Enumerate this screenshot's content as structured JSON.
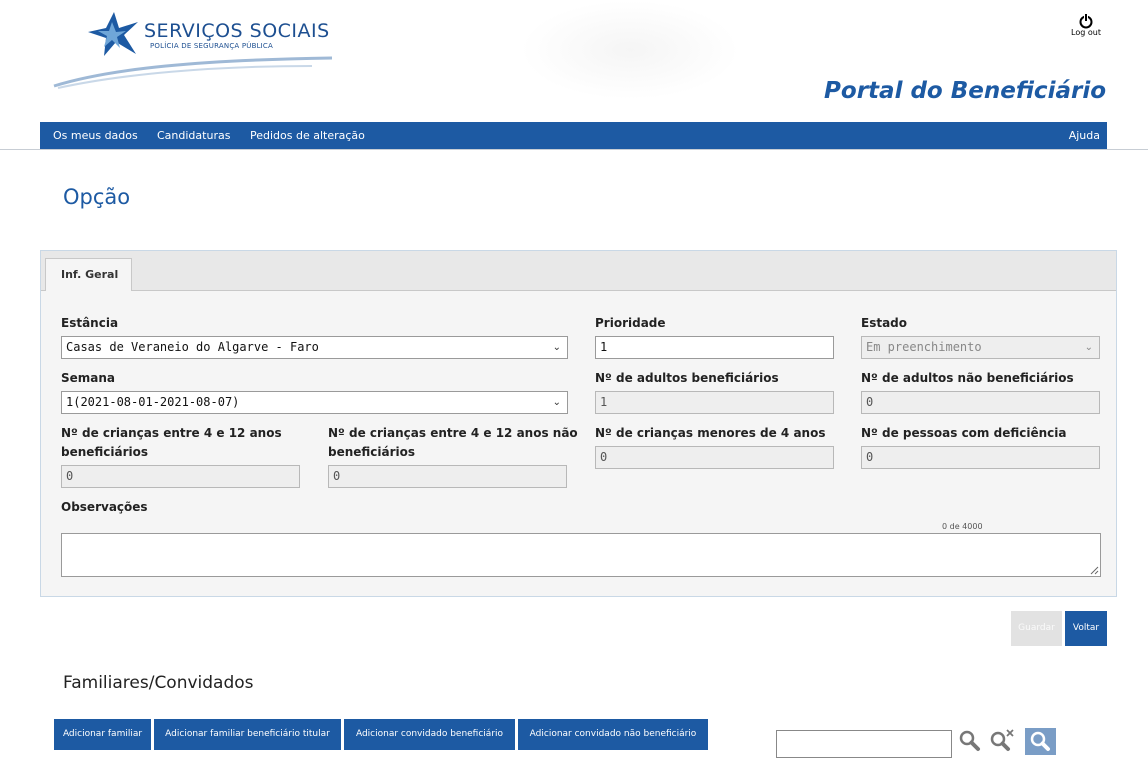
{
  "logo": {
    "title": "SERVIÇOS SOCIAIS",
    "subtitle": "POLÍCIA DE SEGURANÇA PÚBLICA"
  },
  "header": {
    "logout_label": "Log out",
    "portal_title": "Portal do Beneficiário"
  },
  "nav": {
    "items": [
      "Os meus dados",
      "Candidaturas",
      "Pedidos de alteração"
    ],
    "help": "Ajuda"
  },
  "page": {
    "title": "Opção"
  },
  "tabs": [
    "Inf. Geral"
  ],
  "form": {
    "estancia": {
      "label": "Estância",
      "value": "Casas de Veraneio do Algarve - Faro"
    },
    "prioridade": {
      "label": "Prioridade",
      "value": "1"
    },
    "estado": {
      "label": "Estado",
      "value": "Em preenchimento"
    },
    "semana": {
      "label": "Semana",
      "value": "1(2021-08-01-2021-08-07)"
    },
    "adultos_benef": {
      "label": "Nº de adultos beneficiários",
      "value": "1"
    },
    "adultos_nao_benef": {
      "label": "Nº de adultos não beneficiários",
      "value": "0"
    },
    "criancas_benef": {
      "label_line1": "Nº de crianças entre 4 e 12 anos",
      "label_line2": "beneficiários",
      "value": "0"
    },
    "criancas_nao_benef": {
      "label_line1": "Nº de crianças entre 4 e 12 anos não",
      "label_line2": "beneficiários",
      "value": "0"
    },
    "criancas_menores": {
      "label": "Nº de crianças menores de 4 anos",
      "value": "0"
    },
    "deficiencia": {
      "label": "Nº de pessoas com deficiência",
      "value": "0"
    },
    "observacoes": {
      "label": "Observações",
      "counter": "0 de 4000",
      "value": ""
    }
  },
  "actions": {
    "save": "Guardar",
    "back": "Voltar"
  },
  "familiares": {
    "title": "Familiares/Convidados",
    "buttons": [
      "Adicionar familiar",
      "Adicionar familiar beneficiário titular",
      "Adicionar convidado beneficiário",
      "Adicionar convidado não beneficiário"
    ]
  },
  "colors": {
    "primary": "#1d5aa3",
    "panel_bg": "#f5f5f5",
    "readonly_bg": "#eeeeee"
  },
  "icons": [
    "logo-star-icon",
    "power-icon",
    "chevron-down-icon",
    "resize-handle-icon",
    "search-icon",
    "clear-search-icon",
    "search-filled-icon"
  ]
}
